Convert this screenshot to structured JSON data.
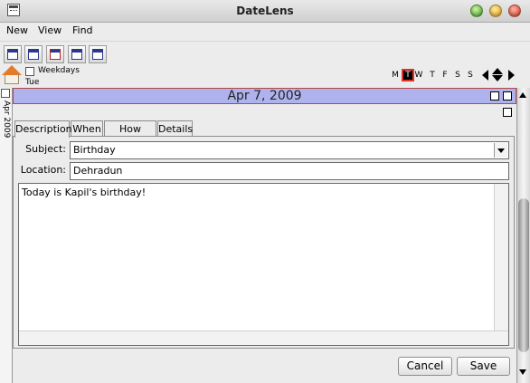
{
  "window": {
    "title": "DateLens"
  },
  "menubar": {
    "items": [
      "New",
      "View",
      "Find"
    ]
  },
  "navrow": {
    "weekdays_label": "Weekdays",
    "day_label": "Tue",
    "days": [
      "M",
      "T",
      "W",
      "T",
      "F",
      "S",
      "S"
    ],
    "active_day_index": 1
  },
  "sidebar": {
    "date_label": "Apr 2009"
  },
  "event": {
    "date_title": "Apr 7, 2009",
    "tabs": [
      "Description",
      "When",
      "How Often",
      "Details"
    ],
    "active_tab": "Description",
    "subject_label": "Subject:",
    "subject_value": "Birthday",
    "location_label": "Location:",
    "location_value": "Dehradun",
    "notes": "Today is Kapil's birthday!"
  },
  "buttons": {
    "cancel": "Cancel",
    "save": "Save"
  },
  "colors": {
    "date_header": "#aeb3ee",
    "header_border": "#b64645",
    "active_day_border": "#e1312a"
  }
}
